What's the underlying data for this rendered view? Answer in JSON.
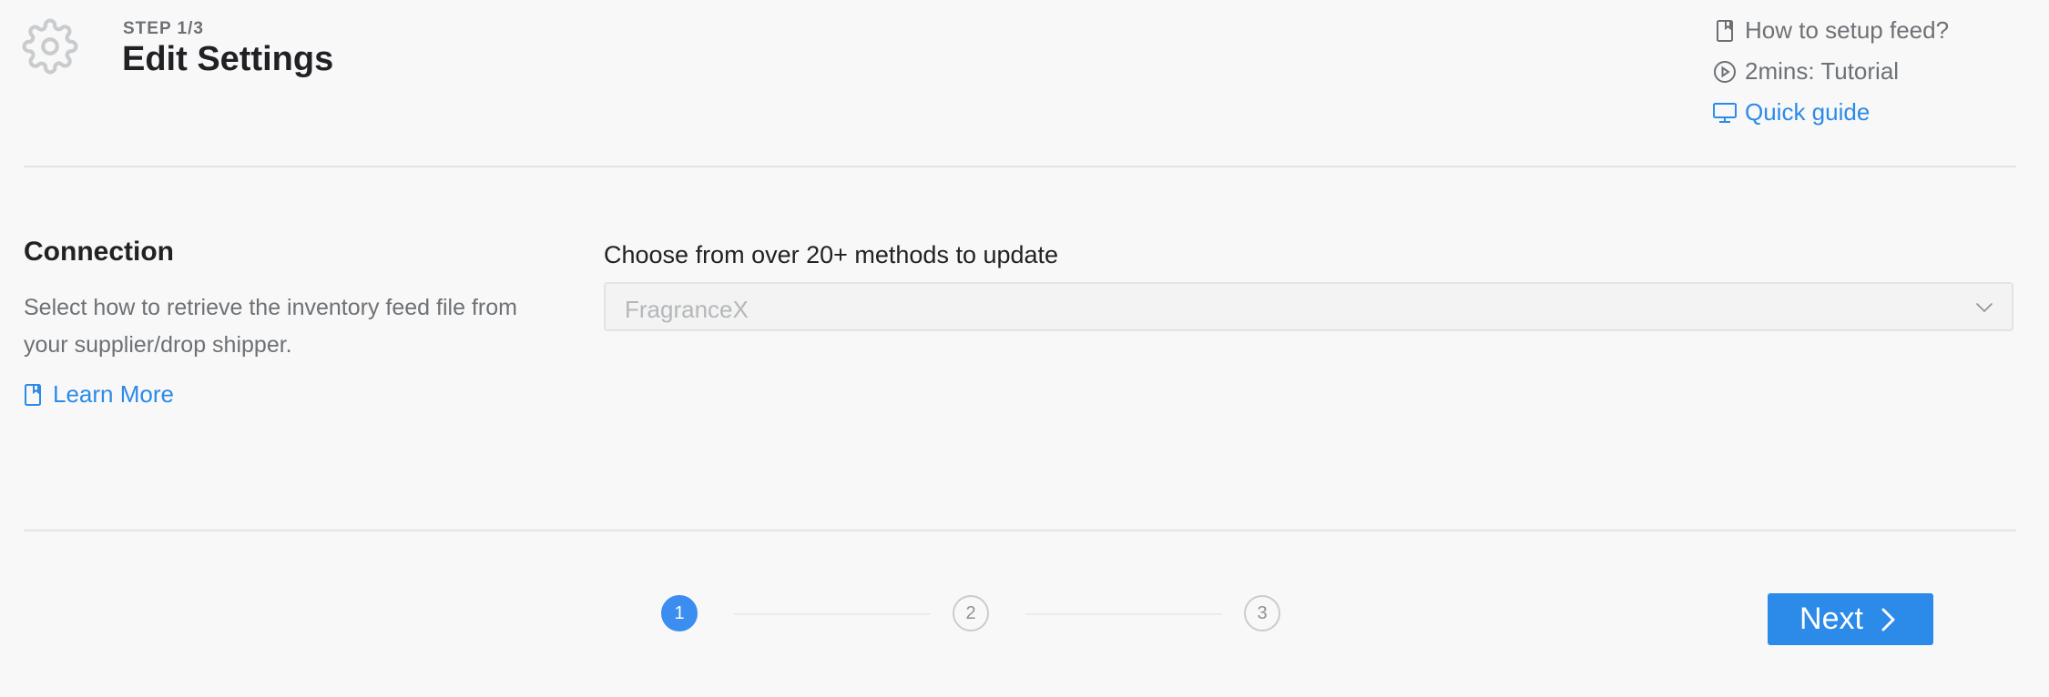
{
  "header": {
    "step": "STEP 1/3",
    "title": "Edit Settings",
    "icon": "gear-icon"
  },
  "help_links": [
    {
      "label": "How to setup feed?",
      "icon": "book-icon",
      "color": "#6d7175"
    },
    {
      "label": "2mins: Tutorial",
      "icon": "play-circle-icon",
      "color": "#6d7175"
    },
    {
      "label": "Quick guide",
      "icon": "monitor-icon",
      "color": "#2c8ae8"
    }
  ],
  "connection": {
    "title": "Connection",
    "description": "Select how to retrieve the inventory feed file from your supplier/drop shipper.",
    "learn_more": "Learn More",
    "method_label": "Choose from over 20+ methods to update",
    "selected_method": "FragranceX"
  },
  "stepper": {
    "steps": [
      "1",
      "2",
      "3"
    ],
    "current": 1,
    "active_color": "#3b8ef0"
  },
  "footer": {
    "next_label": "Next",
    "button_color": "#2c8ae8"
  }
}
